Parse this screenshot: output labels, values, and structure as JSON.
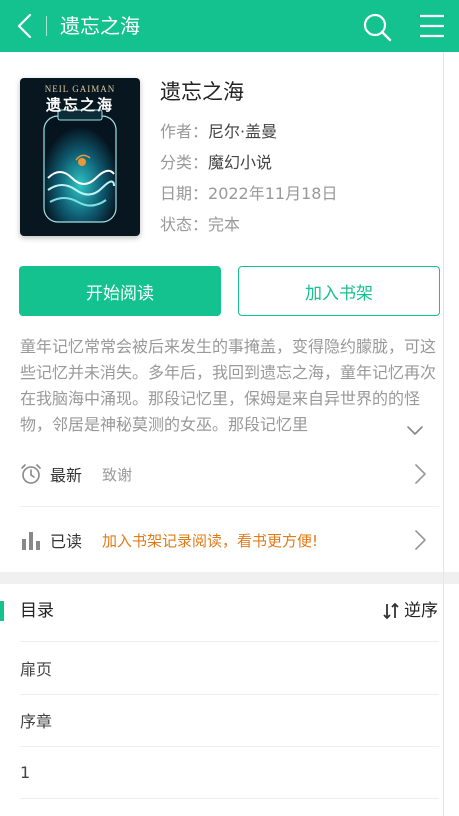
{
  "header": {
    "title": "遗忘之海",
    "background_color": "#14c28f",
    "back_icon": "chevron-left-icon",
    "search_icon": "search-icon",
    "menu_icon": "hamburger-menu-icon"
  },
  "book": {
    "title": "遗忘之海",
    "cover": {
      "author_text": "NEIL GAIMAN",
      "title_text": "遗忘之海"
    },
    "meta": [
      {
        "label": "作者：",
        "value": "尼尔·盖曼"
      },
      {
        "label": "分类：",
        "value": "魔幻小说"
      },
      {
        "label": "日期：",
        "value": "2022年11月18日"
      },
      {
        "label": "状态：",
        "value": "完本"
      }
    ]
  },
  "actions": {
    "read_label": "开始阅读",
    "shelf_label": "加入书架",
    "accent_color": "#14c28f"
  },
  "description": {
    "text": "童年记忆常常会被后来发生的事掩盖，变得隐约朦胧，可这些记忆并未消失。多年后，我回到遗忘之海，童年记忆再次在我脑海中涌现。那段记忆里，保姆是来自异世界的的怪物，邻居是神秘莫测的女巫。那段记忆里"
  },
  "rows": {
    "latest": {
      "label": "最新",
      "value": "致谢",
      "icon": "alarm-clock-icon"
    },
    "read": {
      "label": "已读",
      "value": "加入书架记录阅读，看书更方便!",
      "icon": "bar-chart-icon",
      "value_color": "#e07b1a"
    }
  },
  "toc": {
    "title": "目录",
    "order_label": "逆序",
    "order_icon": "sort-arrows-icon",
    "items": [
      "扉页",
      "序章",
      "1"
    ]
  }
}
